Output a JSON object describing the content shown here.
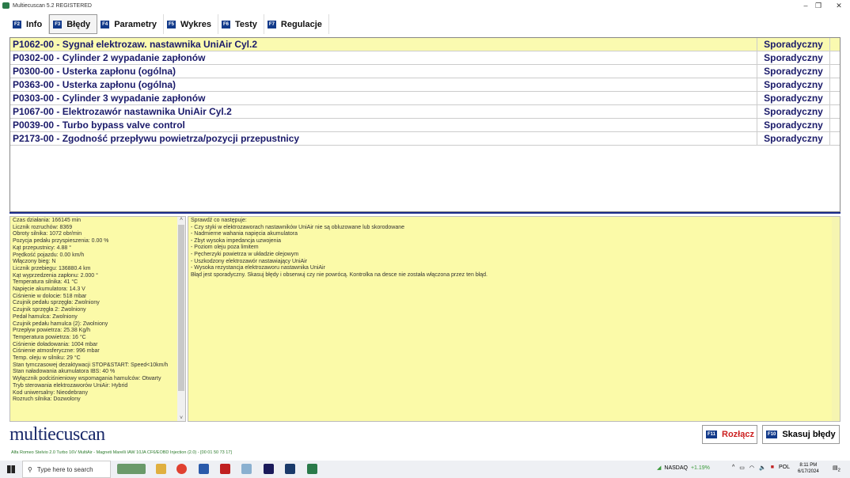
{
  "window": {
    "title": "Multiecuscan 5.2 REGISTERED",
    "minimize": "–",
    "maximize": "❐",
    "close": "✕"
  },
  "tabs": [
    {
      "key": "F2",
      "label": "Info"
    },
    {
      "key": "F3",
      "label": "Błędy"
    },
    {
      "key": "F4",
      "label": "Parametry"
    },
    {
      "key": "F5",
      "label": "Wykres"
    },
    {
      "key": "F6",
      "label": "Testy"
    },
    {
      "key": "F7",
      "label": "Regulacje"
    }
  ],
  "errors": [
    {
      "code": "P1062-00 - Sygnał elektrozaw. nastawnika UniAir Cyl.2",
      "status": "Sporadyczny"
    },
    {
      "code": "P0302-00 - Cylinder 2 wypadanie zapłonów",
      "status": "Sporadyczny"
    },
    {
      "code": "P0300-00 - Usterka zapłonu (ogólna)",
      "status": "Sporadyczny"
    },
    {
      "code": "P0363-00 - Usterka zapłonu (ogólna)",
      "status": "Sporadyczny"
    },
    {
      "code": "P0303-00 - Cylinder 3 wypadanie zapłonów",
      "status": "Sporadyczny"
    },
    {
      "code": "P1067-00 - Elektrozawór nastawnika UniAir Cyl.2",
      "status": "Sporadyczny"
    },
    {
      "code": "P0039-00 - Turbo bypass valve control",
      "status": "Sporadyczny"
    },
    {
      "code": "P2173-00 - Zgodność przepływu powietrza/pozycji przepustnicy",
      "status": "Sporadyczny"
    }
  ],
  "freeze_frame": [
    "Czas działania: 166145 min",
    "Licznik rozruchów: 8369",
    "Obroty silnika: 1072 obr/min",
    "Pozycja pedału przyspieszenia: 0.00 %",
    "Kąt przepustnicy: 4.88 °",
    "Prędkość pojazdu: 0.00 km/h",
    "Włączony bieg: N",
    "Licznik przebiegu: 136880.4 km",
    "Kąt wyprzedzenia zapłonu: 2.000 °",
    "Temperatura silnika: 41 °C",
    "Napięcie akumulatora: 14.3 V",
    "Ciśnienie w dolocie: 518 mbar",
    "Czujnik pedału sprzęgła: Zwolniony",
    "Czujnik sprzęgła 2: Zwolniony",
    "Pedał hamulca: Zwolniony",
    "Czujnik pedału hamulca (2): Zwolniony",
    "Przepływ powietrza: 25.38 Kg/h",
    "Temperatura powietrza: 16 °C",
    "Ciśnienie doładowania: 1004 mbar",
    "Ciśnienie atmosferyczne: 996 mbar",
    "Temp. oleju w silniku: 29 °C",
    "Stan tymczasowej dezaktywacji STOP&START: Speed<10km/h",
    "Stan naładowania akumulatora IBS: 40 %",
    "Wyłącznik podciśnieniowy wspomagania hamulców: Otwarty",
    "Tryb sterowania elektrozaworów UniAir: Hybrid",
    "Kod uniwersalny: Nieodebrany",
    "Rozruch silnika: Dozwolony"
  ],
  "description": [
    "Sprawdź co następuje:",
    "- Czy styki w elektrozaworach nastawników UniAir nie są obluzowane lub skorodowane",
    "- Nadmierne wahania napięcia akumulatora",
    "- Zbyt wysoka impedancja uzwojenia",
    "- Poziom oleju poza limitem",
    "- Pęcherzyki powietrza w układzie olejowym",
    "- Uszkodzony elektrozawór nastawiający UniAir",
    "- Wysoka rezystancja elektrozaworu nastawnika UniAir",
    "Błąd jest sporadyczny. Skasuj błędy i obserwuj czy nie powrócą. Kontrolka na desce nie została włączona przez ten błąd."
  ],
  "brand": "multiecuscan",
  "buttons": {
    "disconnect_key": "F11",
    "disconnect": "Rozłącz",
    "clear_key": "F10",
    "clear": "Skasuj błędy"
  },
  "vehicle": "Alfa Romeo Stelvio 2.0 Turbo 16V MultiAir - Magneti Marelli IAW 10JA CF6/EOBD Injection (2.0) - [00 01 50 73 17]",
  "taskbar": {
    "search_placeholder": "Type here to search",
    "ticker": "NASDAQ",
    "ticker_change": "+1.19%",
    "lang": "POL",
    "time": "8:11 PM",
    "date": "6/17/2024",
    "notifications": "2"
  },
  "colors": {
    "accent": "#1a2a8a",
    "highlight": "#fafab0",
    "panel": "#fbfaa8",
    "disconnect": "#cc2020"
  }
}
